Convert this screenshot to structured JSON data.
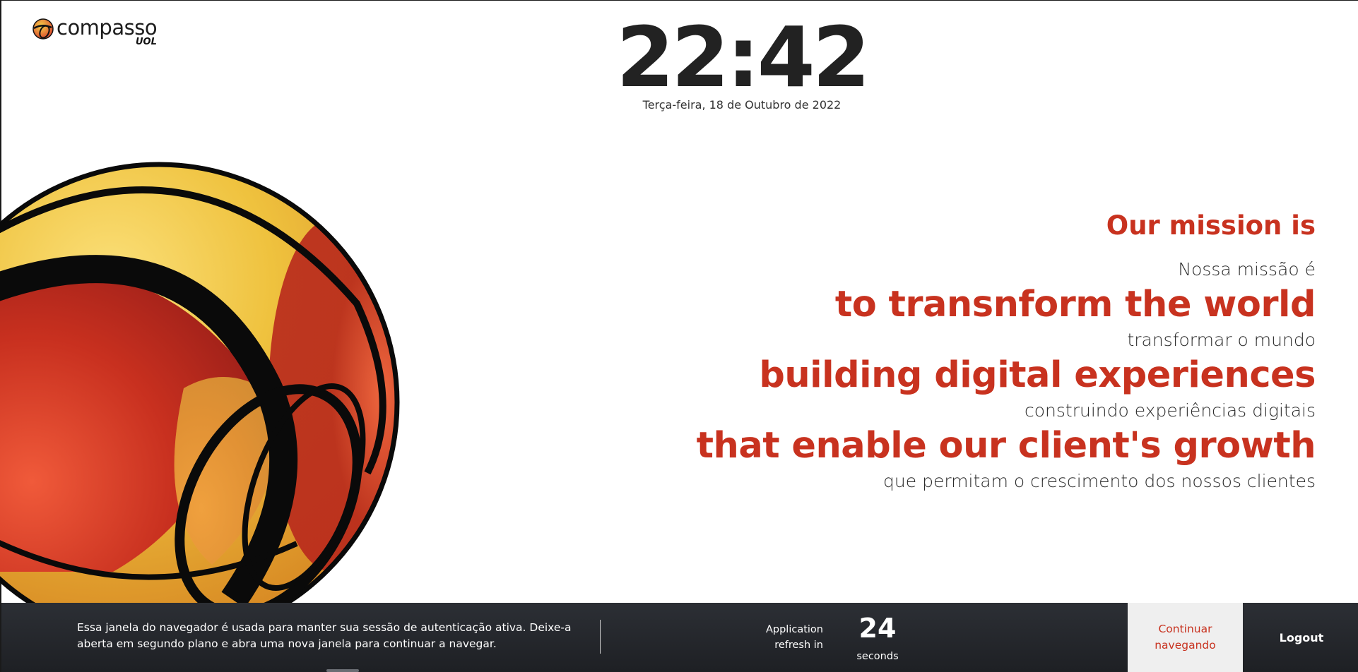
{
  "logo": {
    "brand": "compasso",
    "sub": "UOL",
    "icon": "compasso-logo-icon"
  },
  "clock": {
    "time": "22:42",
    "date": "Terça-feira, 18 de Outubro de 2022"
  },
  "mission": {
    "title": "Our mission is",
    "title_pt": "Nossa missão é",
    "line1": "to transnform the world",
    "line1_pt": "transformar o mundo",
    "line2": "building digital experiences",
    "line2_pt": "construindo experiências digitais",
    "line3": "that enable our client's growth",
    "line3_pt": "que permitam o crescimento dos nossos clientes"
  },
  "footer": {
    "message": "Essa janela do navegador é usada para manter sua sessão de autenticação ativa. Deixe-a aberta em segundo plano e abra uma nova janela para continuar a navegar.",
    "refresh_label_1": "Application",
    "refresh_label_2": "refresh in",
    "countdown": "24",
    "countdown_unit": "seconds",
    "continue_label_1": "Continuar",
    "continue_label_2": "navegando",
    "logout_label": "Logout"
  },
  "colors": {
    "accent": "#c8321f",
    "footer_bg": "#25282d",
    "text_dark": "#222222"
  }
}
